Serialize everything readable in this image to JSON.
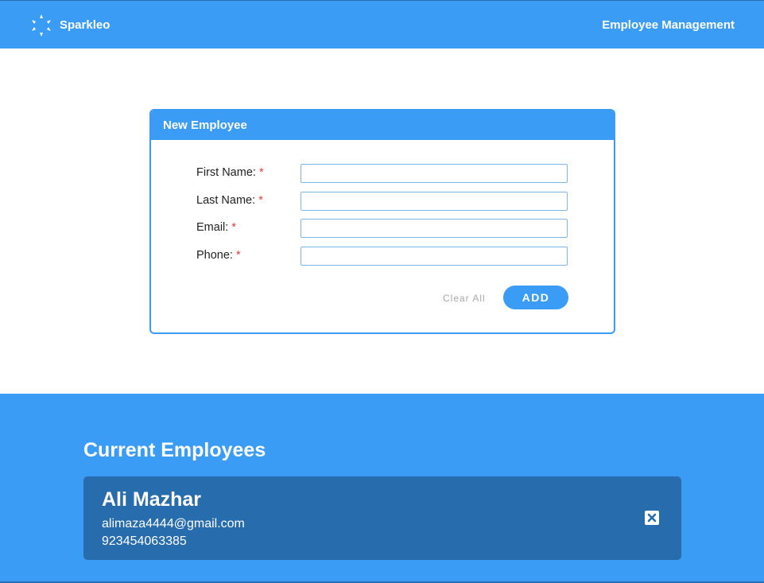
{
  "header": {
    "brand": "Sparkleo",
    "title": "Employee Management",
    "logo_icon": "sparkle-logo-icon"
  },
  "form": {
    "title": "New Employee",
    "required_marker": "*",
    "fields": [
      {
        "label": "First Name:",
        "value": "",
        "placeholder": ""
      },
      {
        "label": "Last Name:",
        "value": "",
        "placeholder": ""
      },
      {
        "label": "Email:",
        "value": "",
        "placeholder": ""
      },
      {
        "label": "Phone:",
        "value": "",
        "placeholder": ""
      }
    ],
    "clear_label": "Clear All",
    "add_label": "ADD"
  },
  "employees": {
    "title": "Current Employees",
    "list": [
      {
        "name": "Ali Mazhar",
        "email": "alimaza4444@gmail.com",
        "phone": "923454063385",
        "delete_icon": "close-icon"
      }
    ]
  },
  "colors": {
    "primary": "#3a9cf5",
    "card_dark": "#276cad",
    "required": "#e23c3c",
    "clear_text": "#a8a8a8"
  }
}
